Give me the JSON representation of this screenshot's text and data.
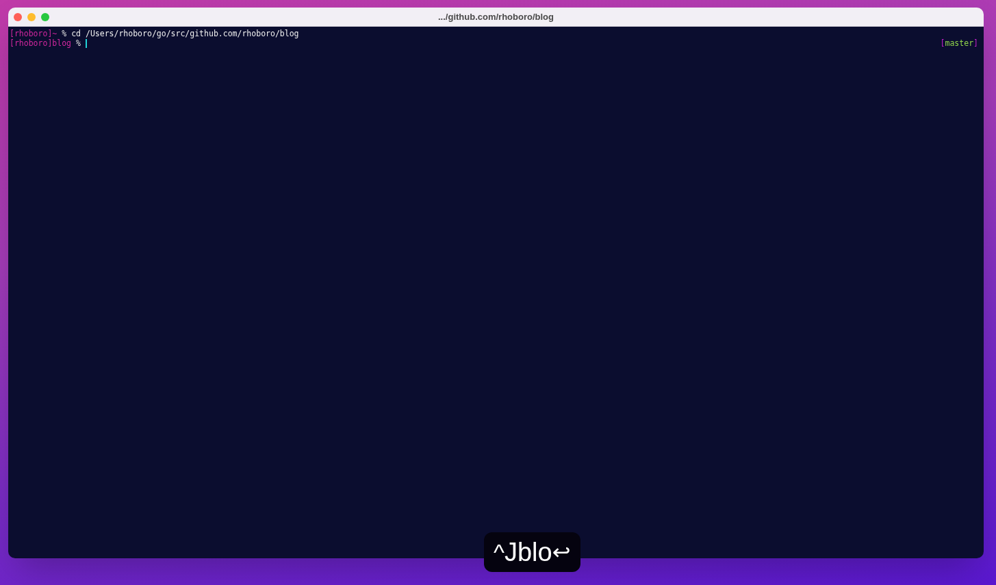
{
  "window": {
    "title": ".../github.com/rhoboro/blog"
  },
  "terminal": {
    "lines": [
      {
        "prompt": "[rhoboro]~",
        "symbol": "%",
        "command": "cd /Users/rhoboro/go/src/github.com/rhoboro/blog",
        "cursor": false
      },
      {
        "prompt": "[rhoboro]blog",
        "symbol": "%",
        "cursor": true
      }
    ],
    "right_prompt": {
      "open": "[",
      "branch": "master",
      "close": "]"
    }
  },
  "keystroke_overlay": {
    "modifier": "^",
    "keys": "Jblo",
    "enter": "↩"
  }
}
